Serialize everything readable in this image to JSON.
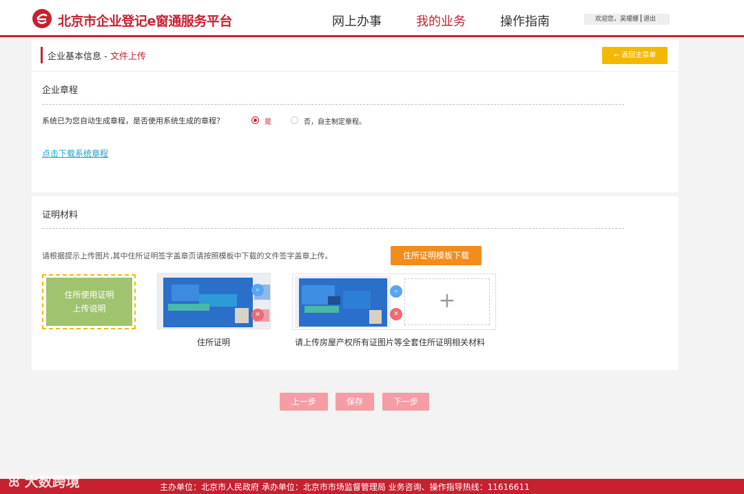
{
  "header": {
    "brand": "北京市企业登记e窗通服务平台",
    "nav": [
      "网上办事",
      "我的业务",
      "操作指南"
    ],
    "user_greeting": "欢迎您，吴瑷娜",
    "logout": "退出",
    "accent_color": "#c7202f"
  },
  "breadcrumb": {
    "section": "企业基本信息",
    "separator": " - ",
    "current": "文件上传"
  },
  "back_button": "← 返回主菜单",
  "articles": {
    "title": "企业章程",
    "question": "系统已为您自动生成章程，是否使用系统生成的章程？",
    "option_yes": "是",
    "option_no": "否，自主制定章程。",
    "selected": "是",
    "download_link": "点击下载系统章程"
  },
  "proof": {
    "title": "证明材料",
    "hint": "请根据提示上传图片,其中住所证明签字盖章页请按照模板中下载的文件签字盖章上传。",
    "template_button": "住所证明模板下载",
    "instruction_line1": "住所使用证明",
    "instruction_line2": "上传说明",
    "caption_residence": "住所证明",
    "caption_property": "请上传房屋产权所有证图片等全套住所证明相关材料",
    "add_icon": "plus-icon",
    "zoom_icon": "zoom-icon",
    "delete_icon": "trash-icon"
  },
  "steps": {
    "prev": "上一步",
    "save": "保存",
    "next": "下一步"
  },
  "footer": {
    "text": "主办单位：北京市人民政府   承办单位：北京市市场监督管理局   业务咨询、操作指导热线：11616611"
  },
  "watermark": "大数跨境"
}
